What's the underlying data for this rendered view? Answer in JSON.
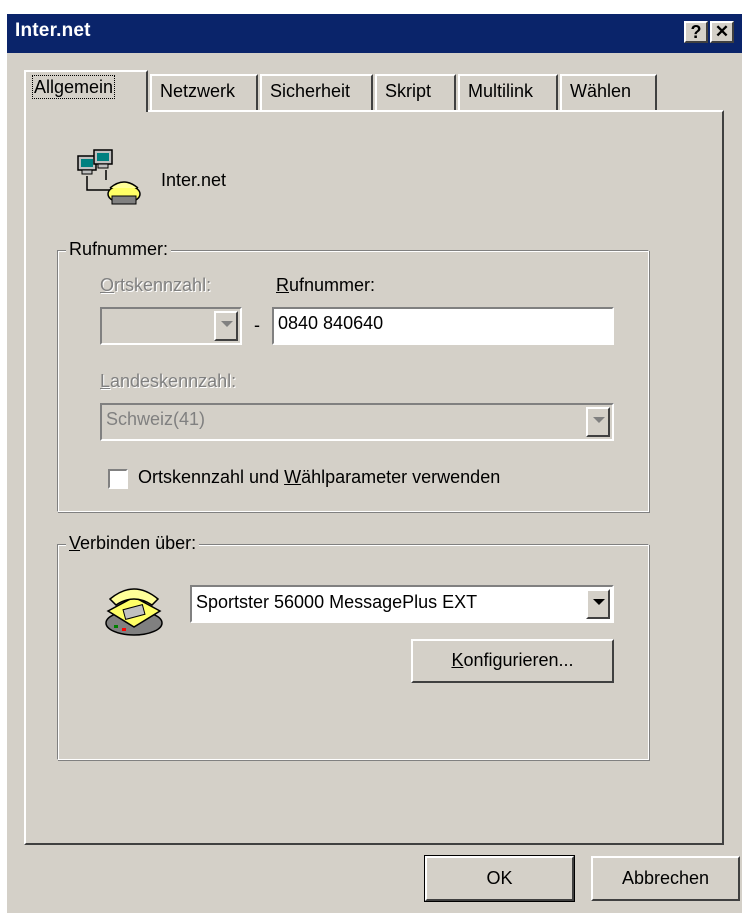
{
  "window": {
    "title": "Inter.net",
    "help_label": "?",
    "close_label": "✕"
  },
  "tabs": [
    "Allgemein",
    "Netzwerk",
    "Sicherheit",
    "Skript",
    "Multilink",
    "Wählen"
  ],
  "connection": {
    "name": "Inter.net",
    "icon": "dial-up-network-icon"
  },
  "phone": {
    "group_label": "Rufnummer:",
    "area_code_label": "Ortskennzahl:",
    "number_label": "Rufnummer:",
    "separator": "-",
    "number_value": "0840 840640",
    "country_label": "Landeskennzahl:",
    "country_value": "Schweiz(41)",
    "use_dialing_rules_label": "Ortskennzahl und Wählparameter verwenden",
    "use_dialing_rules_checked": false
  },
  "connect_via": {
    "group_label": "Verbinden über:",
    "modem_value": "Sportster 56000 MessagePlus EXT",
    "configure_label": "Konfigurieren...",
    "icon": "modem-phone-icon"
  },
  "buttons": {
    "ok": "OK",
    "cancel": "Abbrechen"
  }
}
